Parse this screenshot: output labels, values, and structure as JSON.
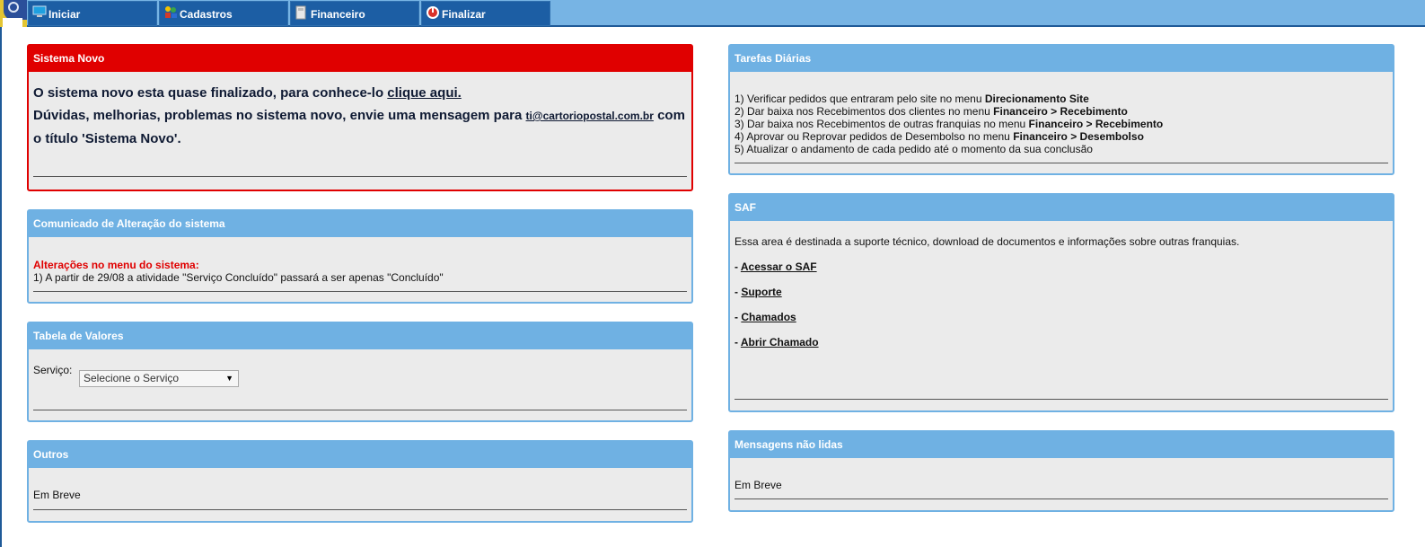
{
  "menu": {
    "items": [
      {
        "label": "Iniciar",
        "icon": "monitor-icon"
      },
      {
        "label": "Cadastros",
        "icon": "people-icon"
      },
      {
        "label": "Financeiro",
        "icon": "calculator-icon"
      },
      {
        "label": "Finalizar",
        "icon": "power-icon"
      }
    ]
  },
  "sistema_novo": {
    "title": "Sistema Novo",
    "line1_prefix": "O sistema novo esta quase finalizado, para conhece-lo ",
    "line1_link": "clique aqui.",
    "line2_prefix": "Dúvidas, melhorias, problemas no sistema novo, envie uma mensagem para ",
    "line2_email": "ti@cartoriopostal.com.br",
    "line2_suffix": " com",
    "line3": "o título 'Sistema Novo'."
  },
  "comunicado": {
    "title": "Comunicado de Alteração do sistema",
    "heading": "Alterações no menu do sistema:",
    "item1": "1) A partir de 29/08 a atividade \"Serviço Concluído\" passará a ser apenas \"Concluído\""
  },
  "tabela": {
    "title": "Tabela de Valores",
    "label": "Serviço:",
    "select_value": "Selecione o Serviço"
  },
  "outros": {
    "title": "Outros",
    "text": "Em Breve"
  },
  "tarefas": {
    "title": "Tarefas Diárias",
    "items": [
      {
        "text": "1) Verificar pedidos que entraram pelo site no menu ",
        "bold": "Direcionamento Site"
      },
      {
        "text": "2) Dar baixa nos Recebimentos dos clientes no menu ",
        "bold": "Financeiro > Recebimento"
      },
      {
        "text": "3) Dar baixa nos Recebimentos de outras franquias no menu ",
        "bold": "Financeiro > Recebimento"
      },
      {
        "text": "4) Aprovar ou Reprovar pedidos de Desembolso no menu ",
        "bold": "Financeiro > Desembolso"
      },
      {
        "text": "5) Atualizar o andamento de cada pedido até o momento da sua conclusão",
        "bold": ""
      }
    ]
  },
  "saf": {
    "title": "SAF",
    "intro": "Essa area é destinada a suporte técnico, download de documentos e informações sobre outras franquias.",
    "dash": "- ",
    "links": [
      "Acessar o SAF",
      "Suporte",
      "Chamados",
      "Abrir Chamado"
    ]
  },
  "mensagens": {
    "title": "Mensagens não lidas",
    "text": "Em Breve"
  }
}
